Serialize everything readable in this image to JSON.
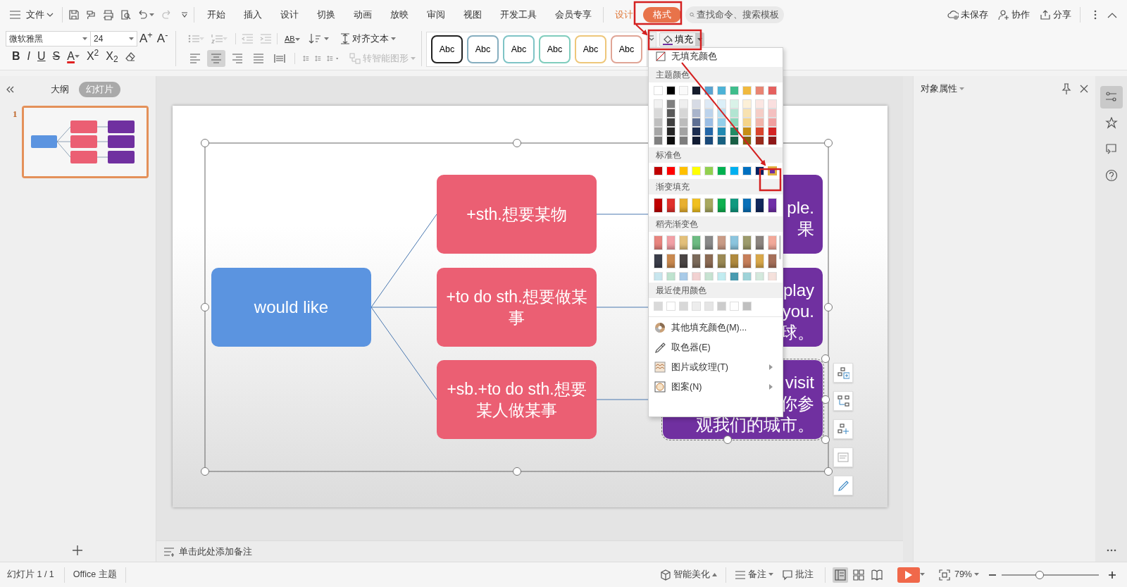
{
  "menu_bar": {
    "file": "文件",
    "tabs": [
      {
        "label": "开始",
        "kind": "normal",
        "selected": false
      },
      {
        "label": "插入",
        "kind": "normal",
        "selected": false
      },
      {
        "label": "设计",
        "kind": "normal",
        "selected": false
      },
      {
        "label": "切换",
        "kind": "normal",
        "selected": false
      },
      {
        "label": "动画",
        "kind": "normal",
        "selected": false
      },
      {
        "label": "放映",
        "kind": "normal",
        "selected": false
      },
      {
        "label": "审阅",
        "kind": "normal",
        "selected": false
      },
      {
        "label": "视图",
        "kind": "normal",
        "selected": false
      },
      {
        "label": "开发工具",
        "kind": "normal",
        "selected": false
      },
      {
        "label": "会员专享",
        "kind": "normal",
        "selected": false
      },
      {
        "label": "设计",
        "kind": "contextual",
        "selected": false
      },
      {
        "label": "格式",
        "kind": "contextual",
        "selected": true
      }
    ],
    "search": {
      "placeholder": "查找命令、搜索模板"
    },
    "actions": [
      "未保存",
      "协作",
      "分享"
    ]
  },
  "ribbon": {
    "font_name": "微软雅黑",
    "font_size": "24",
    "size_buttons": [
      "A$^{+}$",
      "A$^{-}$"
    ],
    "char_buttons": [
      "B",
      "I",
      "U",
      "S",
      "A",
      "X$^{2}$",
      "X$_{2}$"
    ],
    "list_buttons": {
      "disabled": true
    },
    "text_direction": "AB",
    "align_text": "对齐文本",
    "align_buttons": [
      {
        "selected": false
      },
      {
        "selected": true
      },
      {
        "selected": false
      },
      {
        "selected": false
      },
      {
        "selected": false
      }
    ],
    "smart_art": {
      "label": "转智能图形",
      "disabled": true
    },
    "shape_styles": [
      {
        "label": "Abc",
        "color": "#222222"
      },
      {
        "label": "Abc",
        "color": "#86aebf"
      },
      {
        "label": "Abc",
        "color": "#7fc4c6"
      },
      {
        "label": "Abc",
        "color": "#80cdbd"
      },
      {
        "label": "Abc",
        "color": "#eec77a"
      },
      {
        "label": "Abc",
        "color": "#e0a596"
      }
    ],
    "fill_button": "填充"
  },
  "slides_panel": {
    "tabs": [
      {
        "label": "大纲",
        "selected": false
      },
      {
        "label": "幻灯片",
        "selected": true
      }
    ],
    "thumbnails": [
      {
        "number": "1",
        "selected": true
      }
    ]
  },
  "slide": {
    "root": "would like",
    "branches": [
      {
        "text": "+sth.想要某物",
        "leaf_lines": [
          "ple.",
          "果"
        ],
        "selected": false
      },
      {
        "text": "+to do sth.想要做某事",
        "leaf_lines": [
          "play",
          "you.",
          "球。"
        ],
        "selected": false
      },
      {
        "text": "+sb.+to do sth.想要某人做某事",
        "leaf_lines": [
          "visit",
          "你参",
          "观我们的城市。"
        ],
        "selected": true
      }
    ]
  },
  "fill_menu": {
    "no_fill": "无填充颜色",
    "theme_title": "主题颜色",
    "theme_colors": [
      {
        "color": "#ffffff"
      },
      {
        "color": "#000000"
      },
      {
        "color": "#fafafa"
      },
      {
        "color": "#161c2c"
      },
      {
        "color": "#5ba3cf"
      },
      {
        "color": "#4db2d6"
      },
      {
        "color": "#3fbd8c"
      },
      {
        "color": "#f0b93e"
      },
      {
        "color": "#e88573"
      },
      {
        "color": "#e5615f"
      }
    ],
    "theme_shades": [
      [
        {
          "color": "#f2f2f2"
        },
        {
          "color": "#7f7f7f"
        },
        {
          "color": "#efefef"
        },
        {
          "color": "#d7dbe5"
        },
        {
          "color": "#dde9f5"
        },
        {
          "color": "#dbeff8"
        },
        {
          "color": "#d9f2e8"
        },
        {
          "color": "#fcf0d7"
        },
        {
          "color": "#fbe6e2"
        },
        {
          "color": "#fadfdf"
        }
      ],
      [
        {
          "color": "#d9d9d9"
        },
        {
          "color": "#595959"
        },
        {
          "color": "#d6d6d6"
        },
        {
          "color": "#a9b4cb"
        },
        {
          "color": "#bcd3ec"
        },
        {
          "color": "#b6dff1"
        },
        {
          "color": "#b2e5d2"
        },
        {
          "color": "#f8e2b0"
        },
        {
          "color": "#f5cdc6"
        },
        {
          "color": "#f4c0c0"
        }
      ],
      [
        {
          "color": "#bfbfbf"
        },
        {
          "color": "#404040"
        },
        {
          "color": "#bcbcbc"
        },
        {
          "color": "#5e6f93"
        },
        {
          "color": "#9abde4"
        },
        {
          "color": "#93cfea"
        },
        {
          "color": "#8cd8bc"
        },
        {
          "color": "#f5d489"
        },
        {
          "color": "#f1b4aa"
        },
        {
          "color": "#f0a0a0"
        }
      ],
      [
        {
          "color": "#a6a6a6"
        },
        {
          "color": "#262626"
        },
        {
          "color": "#a3a3a3"
        },
        {
          "color": "#1c2d50"
        },
        {
          "color": "#2467a8"
        },
        {
          "color": "#2189b2"
        },
        {
          "color": "#238c65"
        },
        {
          "color": "#c68d14"
        },
        {
          "color": "#d8442c"
        },
        {
          "color": "#d42424"
        }
      ],
      [
        {
          "color": "#808080"
        },
        {
          "color": "#0d0d0d"
        },
        {
          "color": "#7d7d7d"
        },
        {
          "color": "#121c33"
        },
        {
          "color": "#1a4a7a"
        },
        {
          "color": "#186181"
        },
        {
          "color": "#185f45"
        },
        {
          "color": "#85610d"
        },
        {
          "color": "#982a1b"
        },
        {
          "color": "#8f1818"
        }
      ]
    ],
    "standard_title": "标准色",
    "standard_colors": [
      {
        "color": "#c00000",
        "selected": false
      },
      {
        "color": "#ff0000",
        "selected": false
      },
      {
        "color": "#ffc000",
        "selected": false
      },
      {
        "color": "#ffff00",
        "selected": false
      },
      {
        "color": "#92d050",
        "selected": false
      },
      {
        "color": "#00b050",
        "selected": false
      },
      {
        "color": "#00b0f0",
        "selected": false
      },
      {
        "color": "#0070c0",
        "selected": false
      },
      {
        "color": "#002060",
        "selected": false
      },
      {
        "color": "#7030a0",
        "selected": true
      }
    ],
    "gradient_title": "渐变填充",
    "gradient_colors": [
      {
        "color": "#c00000"
      },
      {
        "color": "#e0302c"
      },
      {
        "color": "#e8b030"
      },
      {
        "color": "#f0c020"
      },
      {
        "color": "#a8a860"
      },
      {
        "color": "#10b050"
      },
      {
        "color": "#109a80"
      },
      {
        "color": "#0a70b8"
      },
      {
        "color": "#12295c"
      },
      {
        "color": "#7030a8"
      }
    ],
    "docer_title": "稻壳渐变色",
    "docer_gradients": [
      [
        {
          "color": "#e8857f"
        },
        {
          "color": "#f2a0a6"
        },
        {
          "color": "#e3c07a"
        },
        {
          "color": "#6dbb82"
        },
        {
          "color": "#8a8a8a"
        },
        {
          "color": "#c99b86"
        },
        {
          "color": "#8cc5de"
        },
        {
          "color": "#9d9b6c"
        },
        {
          "color": "#8c8580"
        },
        {
          "color": "#f2a99a"
        }
      ],
      [
        {
          "color": "#3b3e4a"
        },
        {
          "color": "#c9894f"
        },
        {
          "color": "#4a4544"
        },
        {
          "color": "#7b6a5a"
        },
        {
          "color": "#8c6b54"
        },
        {
          "color": "#9b8a55"
        },
        {
          "color": "#b08a3e"
        },
        {
          "color": "#c77f5a"
        },
        {
          "color": "#d9a84a"
        },
        {
          "color": "#a6705a"
        }
      ],
      [
        {
          "color": "#c8e6ee"
        },
        {
          "color": "#bfe3cf"
        },
        {
          "color": "#a9cbe8"
        },
        {
          "color": "#f2d2d2"
        },
        {
          "color": "#c7e3d2"
        },
        {
          "color": "#c2ecf0"
        },
        {
          "color": "#4a9bb0"
        },
        {
          "color": "#9fd3d9"
        },
        {
          "color": "#d4e9dd"
        },
        {
          "color": "#f5e1dc"
        }
      ]
    ],
    "recent_title": "最近使用颜色",
    "recent_colors": [
      {
        "color": "#d9d9d9"
      },
      {
        "color": "#ffffff"
      },
      {
        "color": "#d8d8d8"
      },
      {
        "color": "#ededed"
      },
      {
        "color": "#e5e5e5"
      },
      {
        "color": "#cccccc"
      },
      {
        "color": "#fefefe"
      },
      {
        "color": "#bfbfbf"
      }
    ],
    "items": [
      {
        "label": "其他填充颜色(M)...",
        "has_submenu": false
      },
      {
        "label": "取色器(E)",
        "has_submenu": false
      },
      {
        "label": "图片或纹理(T)",
        "has_submenu": true
      },
      {
        "label": "图案(N)",
        "has_submenu": true
      }
    ]
  },
  "notes": {
    "placeholder": "单击此处添加备注"
  },
  "properties_panel": {
    "title": "对象属性"
  },
  "side_icons": [
    {
      "selected": true
    },
    {
      "selected": false
    },
    {
      "selected": false
    },
    {
      "selected": false
    }
  ],
  "status_bar": {
    "slide": "幻灯片 1 / 1",
    "theme": "Office 主题",
    "beautify": "智能美化",
    "notes": "备注",
    "comments": "批注",
    "views": [
      {
        "selected": true
      },
      {
        "selected": false
      },
      {
        "selected": false
      }
    ],
    "zoom": "79%",
    "zoom_slider": {
      "level": 0.39
    }
  }
}
